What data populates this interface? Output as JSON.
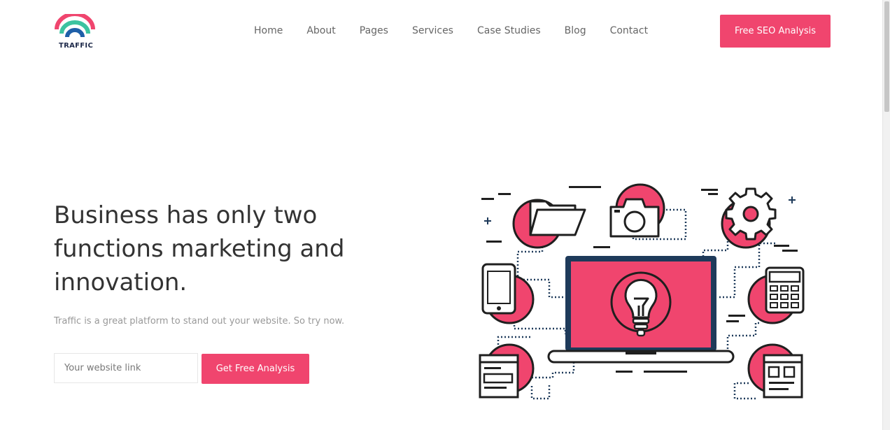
{
  "brand": {
    "name": "TRAFFIC"
  },
  "nav": {
    "items": [
      "Home",
      "About",
      "Pages",
      "Services",
      "Case Studies",
      "Blog",
      "Contact"
    ]
  },
  "header": {
    "cta_label": "Free SEO Analysis"
  },
  "hero": {
    "title": "Business has only two functions marketing and innovation.",
    "subtitle": "Traffic is a great platform to stand out your website. So try now.",
    "input_placeholder": "Your website link",
    "input_value": "",
    "button_label": "Get Free Analysis"
  },
  "colors": {
    "accent": "#f0456e",
    "logo_teal": "#3cc3a0",
    "logo_blue": "#1e5fa8",
    "dark": "#1f1f1f",
    "navy": "#1e3a5a"
  },
  "icons": [
    "folder-icon",
    "camera-icon",
    "gear-icon",
    "phone-icon",
    "calculator-icon",
    "browser-window-icon",
    "layout-icon",
    "laptop-icon",
    "lightbulb-icon"
  ]
}
